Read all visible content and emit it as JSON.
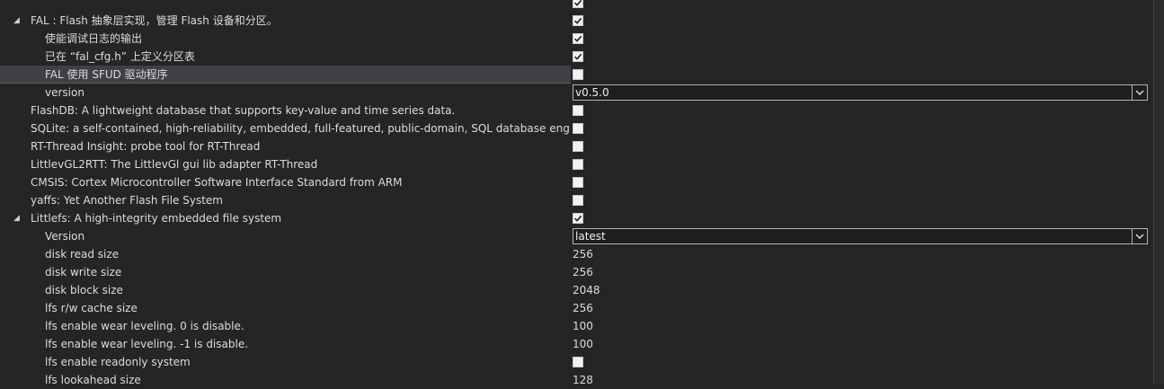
{
  "rows": [
    {
      "label": "",
      "indent": 1,
      "kind": "checkbox",
      "checked": true,
      "selected": false,
      "expander": ""
    },
    {
      "label": "FAL : Flash 抽象层实现，管理 Flash 设备和分区。",
      "indent": 1,
      "kind": "checkbox",
      "checked": true,
      "selected": false,
      "expander": "◢"
    },
    {
      "label": "使能调试日志的输出",
      "indent": 2,
      "kind": "checkbox",
      "checked": true,
      "selected": false,
      "expander": ""
    },
    {
      "label": "已在 “fal_cfg.h” 上定义分区表",
      "indent": 2,
      "kind": "checkbox",
      "checked": true,
      "selected": false,
      "expander": ""
    },
    {
      "label": "FAL 使用 SFUD 驱动程序",
      "indent": 2,
      "kind": "checkbox",
      "checked": false,
      "selected": true,
      "expander": ""
    },
    {
      "label": "version",
      "indent": 2,
      "kind": "combo",
      "value": "v0.5.0",
      "selected": false,
      "expander": ""
    },
    {
      "label": "FlashDB: A lightweight database that supports key-value and time series data.",
      "indent": 1,
      "kind": "checkbox",
      "checked": false,
      "selected": false,
      "expander": ""
    },
    {
      "label": "SQLite: a self-contained, high-reliability, embedded, full-featured, public-domain, SQL database engine.",
      "indent": 1,
      "kind": "checkbox",
      "checked": false,
      "selected": false,
      "expander": ""
    },
    {
      "label": "RT-Thread Insight: probe tool for RT-Thread",
      "indent": 1,
      "kind": "checkbox",
      "checked": false,
      "selected": false,
      "expander": ""
    },
    {
      "label": "LittlevGL2RTT: The LittlevGl gui lib adapter RT-Thread",
      "indent": 1,
      "kind": "checkbox",
      "checked": false,
      "selected": false,
      "expander": ""
    },
    {
      "label": "CMSIS: Cortex Microcontroller Software Interface Standard from ARM",
      "indent": 1,
      "kind": "checkbox",
      "checked": false,
      "selected": false,
      "expander": ""
    },
    {
      "label": "yaffs: Yet Another Flash File System",
      "indent": 1,
      "kind": "checkbox",
      "checked": false,
      "selected": false,
      "expander": ""
    },
    {
      "label": "Littlefs: A high-integrity embedded file system",
      "indent": 1,
      "kind": "checkbox",
      "checked": true,
      "selected": false,
      "expander": "◢"
    },
    {
      "label": "Version",
      "indent": 2,
      "kind": "combo",
      "value": "latest",
      "selected": false,
      "expander": ""
    },
    {
      "label": "disk read size",
      "indent": 2,
      "kind": "text",
      "value": "256",
      "selected": false,
      "expander": ""
    },
    {
      "label": "disk write size",
      "indent": 2,
      "kind": "text",
      "value": "256",
      "selected": false,
      "expander": ""
    },
    {
      "label": "disk block size",
      "indent": 2,
      "kind": "text",
      "value": "2048",
      "selected": false,
      "expander": ""
    },
    {
      "label": "lfs r/w cache size",
      "indent": 2,
      "kind": "text",
      "value": "256",
      "selected": false,
      "expander": ""
    },
    {
      "label": "lfs enable wear leveling. 0 is disable.",
      "indent": 2,
      "kind": "text",
      "value": "100",
      "selected": false,
      "expander": ""
    },
    {
      "label": "lfs enable wear leveling. -1 is disable.",
      "indent": 2,
      "kind": "text",
      "value": "100",
      "selected": false,
      "expander": ""
    },
    {
      "label": "lfs enable readonly system",
      "indent": 2,
      "kind": "checkbox",
      "checked": false,
      "selected": false,
      "expander": ""
    },
    {
      "label": "lfs lookahead size",
      "indent": 2,
      "kind": "text",
      "value": "128",
      "selected": false,
      "expander": ""
    }
  ],
  "icons": {
    "expander": "collapse-triangle-icon",
    "combo_button": "chevron-down-icon",
    "check": "checkmark-icon"
  },
  "colors": {
    "background": "#252526",
    "text": "#dcdcdc",
    "selected_row": "#3f3f46",
    "checkbox_fill": "#f2f2f2"
  }
}
